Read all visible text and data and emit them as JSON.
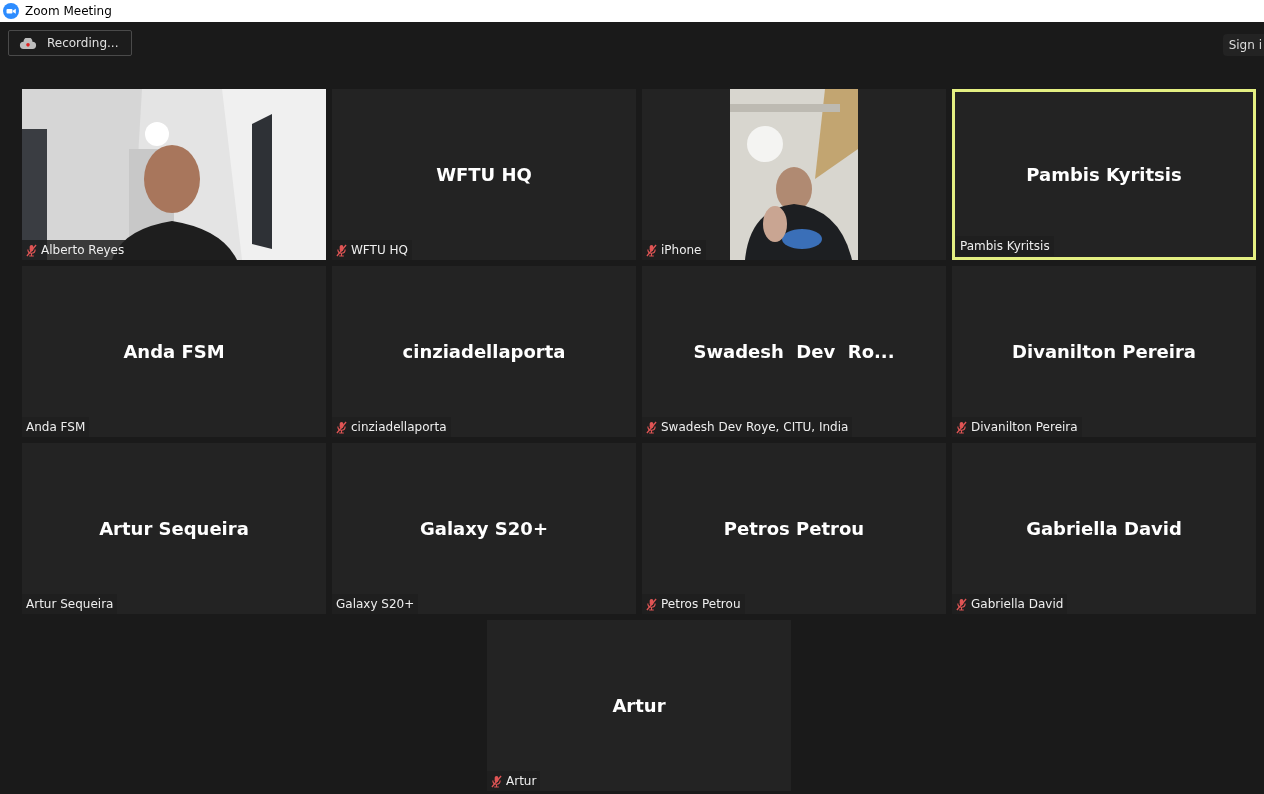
{
  "window": {
    "title": "Zoom Meeting"
  },
  "recording": {
    "label": "Recording..."
  },
  "sign_in": {
    "label": "Sign i"
  },
  "participants": [
    {
      "label": "Alberto Reyes",
      "muted": true,
      "kind": "video",
      "speaking": false
    },
    {
      "display": "WFTU HQ",
      "label": "WFTU HQ",
      "muted": true,
      "kind": "name",
      "speaking": false
    },
    {
      "label": "iPhone",
      "muted": true,
      "kind": "portrait",
      "speaking": false
    },
    {
      "display": "Pambis Kyritsis",
      "label": "Pambis Kyritsis",
      "muted": false,
      "kind": "name",
      "speaking": true
    },
    {
      "display": "Anda FSM",
      "label": "Anda FSM",
      "muted": false,
      "kind": "name",
      "speaking": false
    },
    {
      "display": "cinziadellaporta",
      "label": "cinziadellaporta",
      "muted": true,
      "kind": "name",
      "speaking": false
    },
    {
      "display": "Swadesh  Dev  Ro...",
      "label": "Swadesh Dev Roye, CITU, India",
      "muted": true,
      "kind": "name",
      "speaking": false
    },
    {
      "display": "Divanilton Pereira",
      "label": "Divanilton Pereira",
      "muted": true,
      "kind": "name",
      "speaking": false
    },
    {
      "display": "Artur Sequeira",
      "label": "Artur Sequeira",
      "muted": false,
      "kind": "name",
      "speaking": false
    },
    {
      "display": "Galaxy S20+",
      "label": "Galaxy S20+",
      "muted": false,
      "kind": "name",
      "speaking": false
    },
    {
      "display": "Petros Petrou",
      "label": "Petros Petrou",
      "muted": true,
      "kind": "name",
      "speaking": false
    },
    {
      "display": "Gabriella David",
      "label": "Gabriella David",
      "muted": true,
      "kind": "name",
      "speaking": false
    },
    {
      "display": "Artur",
      "label": "Artur",
      "muted": true,
      "kind": "name",
      "speaking": false
    }
  ]
}
